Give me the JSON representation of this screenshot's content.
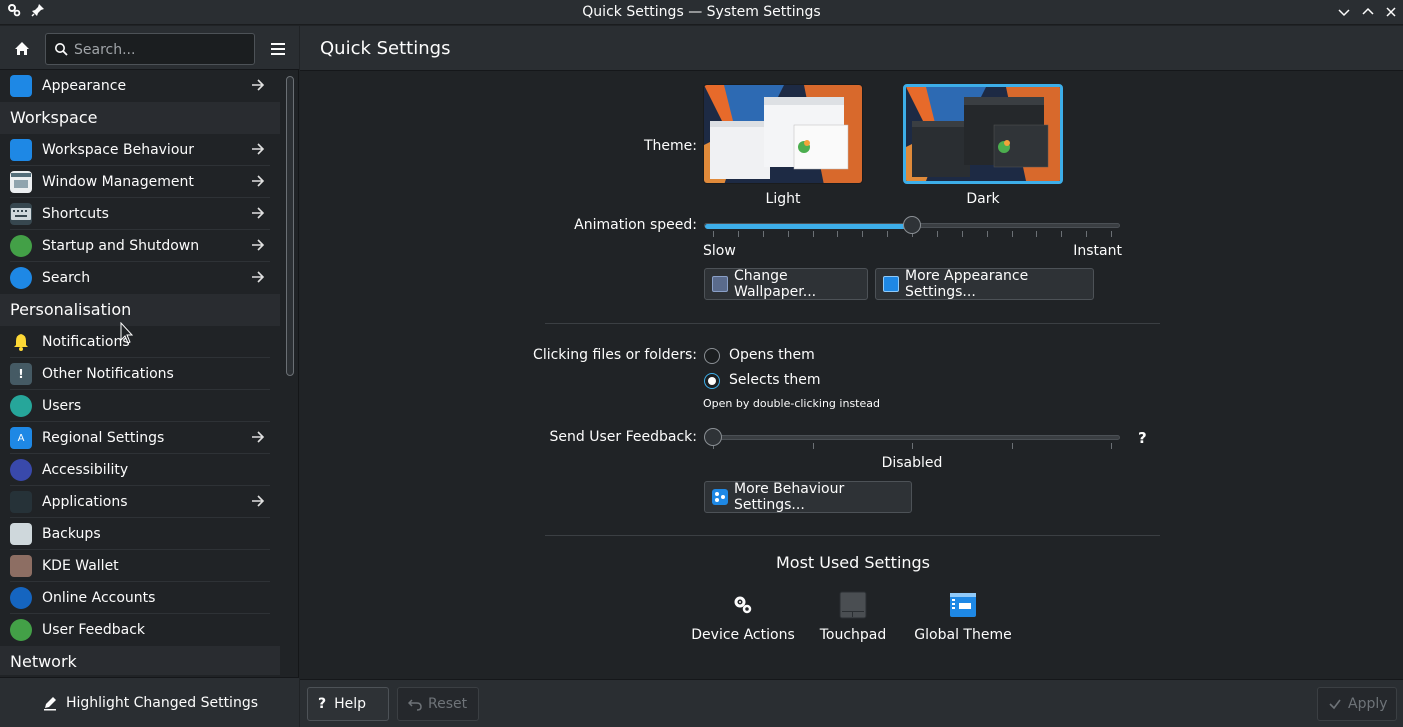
{
  "window": {
    "title": "Quick Settings — System Settings"
  },
  "sidebar": {
    "search_placeholder": "Search...",
    "items": [
      {
        "label": "Appearance",
        "icon": "appearance-icon",
        "arrow": true
      },
      {
        "category": "Workspace"
      },
      {
        "label": "Workspace Behaviour",
        "icon": "workspace-icon",
        "arrow": true
      },
      {
        "label": "Window Management",
        "icon": "window-icon",
        "arrow": true
      },
      {
        "label": "Shortcuts",
        "icon": "keyboard-icon",
        "arrow": true
      },
      {
        "label": "Startup and Shutdown",
        "icon": "rocket-icon",
        "arrow": true
      },
      {
        "label": "Search",
        "icon": "search-icon",
        "arrow": true
      },
      {
        "category": "Personalisation"
      },
      {
        "label": "Notifications",
        "icon": "bell-icon",
        "arrow": false
      },
      {
        "label": "Other Notifications",
        "icon": "info-bubble-icon",
        "arrow": false
      },
      {
        "label": "Users",
        "icon": "users-icon",
        "arrow": false
      },
      {
        "label": "Regional Settings",
        "icon": "language-icon",
        "arrow": true
      },
      {
        "label": "Accessibility",
        "icon": "accessibility-icon",
        "arrow": false
      },
      {
        "label": "Applications",
        "icon": "applications-icon",
        "arrow": true
      },
      {
        "label": "Backups",
        "icon": "backup-icon",
        "arrow": false
      },
      {
        "label": "KDE Wallet",
        "icon": "wallet-icon",
        "arrow": false
      },
      {
        "label": "Online Accounts",
        "icon": "online-accounts-icon",
        "arrow": false
      },
      {
        "label": "User Feedback",
        "icon": "feedback-icon",
        "arrow": false
      },
      {
        "category": "Network"
      }
    ],
    "highlight_label": "Highlight Changed Settings"
  },
  "page": {
    "title": "Quick Settings",
    "theme_label": "Theme:",
    "themes": [
      {
        "label": "Light",
        "selected": false
      },
      {
        "label": "Dark",
        "selected": true
      }
    ],
    "animation_label": "Animation speed:",
    "animation_min": "Slow",
    "animation_max": "Instant",
    "animation_value": 0.5,
    "change_wallpaper": "Change Wallpaper...",
    "more_appearance": "More Appearance Settings...",
    "clicking_label": "Clicking files or folders:",
    "click_options": [
      {
        "label": "Opens them",
        "checked": false
      },
      {
        "label": "Selects them",
        "checked": true
      }
    ],
    "click_hint": "Open by double-clicking instead",
    "feedback_label": "Send User Feedback:",
    "feedback_value_label": "Disabled",
    "feedback_value": 0,
    "help_glyph": "?",
    "more_behaviour": "More Behaviour Settings...",
    "most_used_title": "Most Used Settings",
    "most_used": [
      {
        "label": "Device Actions",
        "icon": "gears-icon"
      },
      {
        "label": "Touchpad",
        "icon": "touchpad-icon"
      },
      {
        "label": "Global Theme",
        "icon": "global-theme-icon"
      }
    ]
  },
  "footer": {
    "help": "Help",
    "reset": "Reset",
    "apply": "Apply"
  },
  "colors": {
    "accent": "#3daee9",
    "background": "#202326",
    "header": "#2a2e32"
  }
}
